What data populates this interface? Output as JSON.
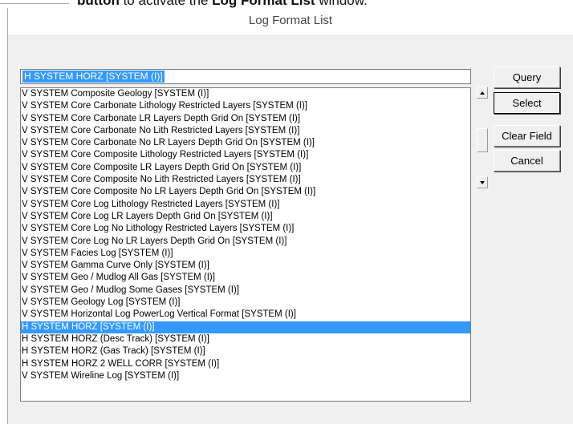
{
  "caption": {
    "bold_text": "button",
    "mid_text": " to activate the ",
    "bold_text_2": "Log Format List",
    "end_text": " window."
  },
  "window": {
    "title": "Log Format List"
  },
  "search": {
    "value": "H  SYSTEM HORZ [SYSTEM (I)]"
  },
  "list": {
    "items": [
      "V  SYSTEM Composite Geology [SYSTEM (I)]",
      "V  SYSTEM Core Carbonate Lithology Restricted Layers [SYSTEM (I)]",
      "V  SYSTEM Core Carbonate LR Layers Depth Grid On [SYSTEM (I)]",
      "V  SYSTEM Core Carbonate No Lith Restricted Layers [SYSTEM (I)]",
      "V  SYSTEM Core Carbonate No LR Layers Depth Grid On [SYSTEM (I)]",
      "V  SYSTEM Core Composite Lithology Restricted Layers [SYSTEM (I)]",
      "V  SYSTEM Core Composite LR Layers Depth Grid On [SYSTEM (I)]",
      "V  SYSTEM Core Composite No Lith Restricted Layers [SYSTEM (I)]",
      "V  SYSTEM Core Composite No LR Layers Depth Grid On [SYSTEM (I)]",
      "V  SYSTEM Core Log Lithology Restricted Layers [SYSTEM (I)]",
      "V  SYSTEM Core Log LR Layers Depth Grid On [SYSTEM (I)]",
      "V  SYSTEM Core Log No Lithology Restricted Layers [SYSTEM (I)]",
      "V  SYSTEM Core Log No LR Layers Depth Grid On [SYSTEM (I)]",
      "V  SYSTEM Facies Log [SYSTEM (I)]",
      "V  SYSTEM Gamma Curve Only [SYSTEM (I)]",
      "V  SYSTEM Geo / Mudlog All Gas [SYSTEM (I)]",
      "V  SYSTEM Geo / Mudlog Some Gases [SYSTEM (I)]",
      "V  SYSTEM Geology Log [SYSTEM (I)]",
      "V  SYSTEM Horizontal Log PowerLog Vertical Format [SYSTEM (I)]",
      "H  SYSTEM HORZ [SYSTEM (I)]",
      "H  SYSTEM HORZ (Desc Track) [SYSTEM (I)]",
      "H  SYSTEM HORZ (Gas Track) [SYSTEM (I)]",
      "H  SYSTEM HORZ 2 WELL CORR [SYSTEM (I)]",
      "V  SYSTEM Wireline Log [SYSTEM (I)]"
    ],
    "selected_index": 19
  },
  "buttons": {
    "query": "Query",
    "select": "Select",
    "clear_field": "Clear Field",
    "cancel": "Cancel"
  },
  "icons": {
    "scroll_up": "up-arrow-icon",
    "scroll_down": "down-arrow-icon"
  },
  "colors": {
    "selection": "#3399ff",
    "window_bg": "#f0f0f0"
  }
}
